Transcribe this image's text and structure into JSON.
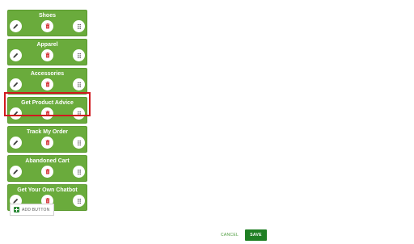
{
  "menu_buttons": [
    {
      "label": "Shoes"
    },
    {
      "label": "Apparel"
    },
    {
      "label": "Accessories"
    },
    {
      "label": "Get Product Advice",
      "highlighted": true
    },
    {
      "label": "Track My Order"
    },
    {
      "label": "Abandoned Cart"
    },
    {
      "label": "Get Your Own Chatbot"
    }
  ],
  "icons": {
    "edit": "pencil-icon",
    "delete": "trash-icon",
    "drag": "drag-handle-icon",
    "add": "plus-square-icon"
  },
  "colors": {
    "card_green": "#6aab3c",
    "delete_red": "#d0181e",
    "highlight_red": "#d0181e",
    "save_green": "#1f7f23",
    "cancel_text": "#4a9a3a"
  },
  "actions": {
    "add_button_label": "ADD BUTTON",
    "cancel_label": "CANCEL",
    "save_label": "SAVE"
  }
}
